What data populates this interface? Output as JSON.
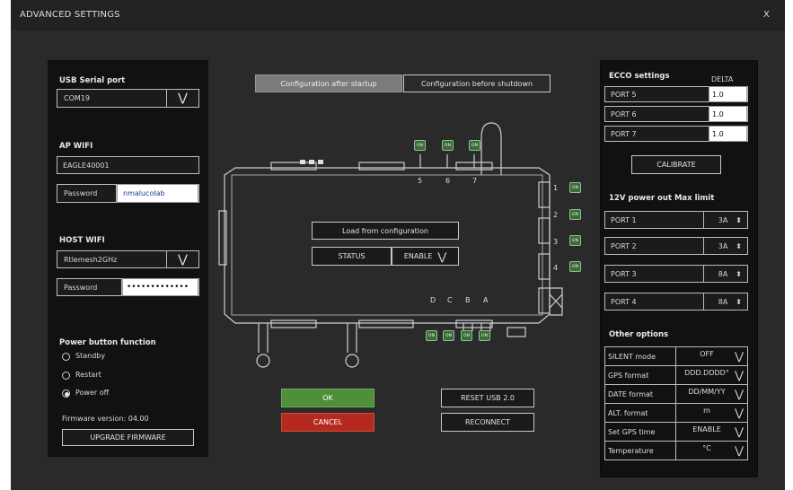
{
  "window": {
    "title": "ADVANCED SETTINGS",
    "close": "X"
  },
  "usb": {
    "label": "USB Serial port",
    "value": "COM19"
  },
  "ap_wifi": {
    "label": "AP WIFI",
    "ssid": "EAGLE40001",
    "password_label": "Password",
    "password_value": "nmalucolab"
  },
  "host_wifi": {
    "label": "HOST WIFI",
    "ssid": "Rtlemesh2GHz",
    "password_label": "Password",
    "password_value": "•••••••••••••"
  },
  "power_button": {
    "label": "Power button function",
    "options": [
      "Standby",
      "Restart",
      "Power off"
    ],
    "selected": "Power off"
  },
  "firmware": {
    "version_text": "Firmware version: 04.00",
    "upgrade_label": "UPGRADE FIRMWARE"
  },
  "config_tabs": [
    "Configuration after startup",
    "Configuration before shutdown"
  ],
  "center": {
    "load_label": "Load from configuration",
    "status_label": "STATUS",
    "status_value": "ENABLE",
    "top_ports": [
      "5",
      "6",
      "7"
    ],
    "side_ports": [
      "1",
      "2",
      "3",
      "4"
    ],
    "bottom_ports": [
      "D",
      "C",
      "B",
      "A"
    ],
    "on_text": "ON"
  },
  "actions": {
    "ok": "OK",
    "cancel": "CANCEL",
    "reset_usb": "RESET USB 2.0",
    "reconnect": "RECONNECT"
  },
  "ecco": {
    "title": "ECCO settings",
    "delta_label": "DELTA",
    "ports": [
      {
        "name": "PORT 5",
        "value": "1.0"
      },
      {
        "name": "PORT 6",
        "value": "1.0"
      },
      {
        "name": "PORT 7",
        "value": "1.0"
      }
    ],
    "calibrate_label": "CALIBRATE"
  },
  "power_out": {
    "title": "12V power out Max limit",
    "ports": [
      {
        "name": "PORT 1",
        "value": "3A"
      },
      {
        "name": "PORT 2",
        "value": "3A"
      },
      {
        "name": "PORT 3",
        "value": "8A"
      },
      {
        "name": "PORT 4",
        "value": "8A"
      }
    ]
  },
  "other": {
    "title": "Other options",
    "rows": [
      {
        "name": "SILENT mode",
        "value": "OFF"
      },
      {
        "name": "GPS format",
        "value": "DDD.DDDD°"
      },
      {
        "name": "DATE format",
        "value": "DD/MM/YY"
      },
      {
        "name": "ALT. format",
        "value": "m"
      },
      {
        "name": "Set GPS time",
        "value": "ENABLE"
      },
      {
        "name": "Temperature",
        "value": "°C"
      }
    ]
  },
  "colors": {
    "ok_green": "#4f8f3a",
    "cancel_red": "#b52a1e",
    "on_green": "#3a6b3a"
  }
}
